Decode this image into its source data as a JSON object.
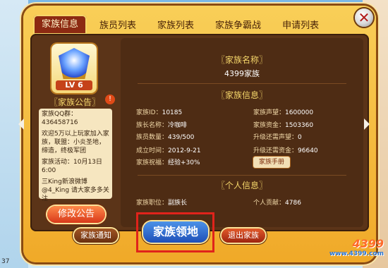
{
  "tabs": [
    {
      "label": "家族信息"
    },
    {
      "label": "族员列表"
    },
    {
      "label": "家族列表"
    },
    {
      "label": "家族争霸战"
    },
    {
      "label": "申请列表"
    }
  ],
  "badge": {
    "level": "LV 6"
  },
  "notice": {
    "title": "〖家族公告〗",
    "qq": "家族QQ群：436458716",
    "intro": "欢迎5万以上玩家加入家族，联盟：小炎圣地，缔造，终极军团",
    "activity": "家族活动：10月13日 6:00",
    "weibo": "三King新浪微博 @4_King 请大家多多关注",
    "edit_label": "修改公告"
  },
  "family": {
    "name_title": "〖家族名称〗",
    "name": "4399家族",
    "info_title": "〖家族信息〗",
    "id_label": "家族ID：",
    "id": "10185",
    "leader_label": "族长名称：",
    "leader": "冷咖啡",
    "members_label": "族员数量：",
    "members": "439/500",
    "created_label": "成立时间：",
    "created": "2012-9-21",
    "bless_label": "家族祝福：",
    "bless": "经验+30%",
    "prestige_label": "家族声望：",
    "prestige": "1600000",
    "funds_label": "家族资金：",
    "funds": "1503360",
    "upgrade_prestige_label": "升级还需声望：",
    "upgrade_prestige": "0",
    "upgrade_funds_label": "升级还需资金：",
    "upgrade_funds": "96640",
    "handbook_label": "家族手册"
  },
  "personal": {
    "title": "〖个人信息〗",
    "role_label": "家族职位：",
    "role": "副族长",
    "contrib_label": "个人贡献：",
    "contrib": "4786"
  },
  "buttons": {
    "notify": "家族通知",
    "territory": "家族领地",
    "exit": "退出家族"
  },
  "logo": {
    "name": "4399",
    "site": "www.4399.com"
  },
  "corner": "37"
}
